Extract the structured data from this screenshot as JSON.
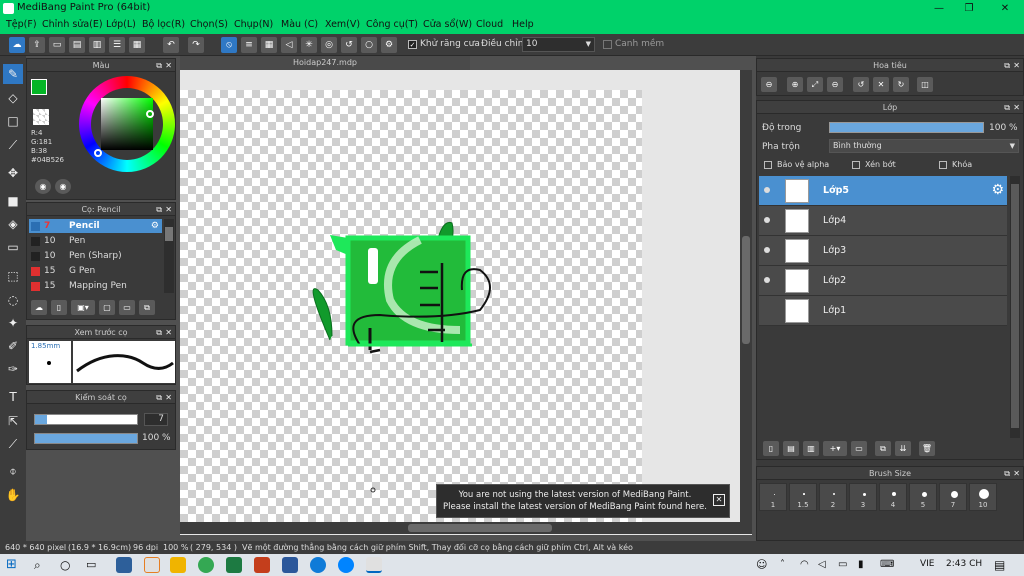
{
  "app": {
    "title": "MediBang Paint Pro (64bit)"
  },
  "menu": [
    "Tệp(F)",
    "Chỉnh sửa(E)",
    "Lớp(L)",
    "Bộ lọc(R)",
    "Chọn(S)",
    "Chụp(N)",
    "Màu (C)",
    "Xem(V)",
    "Công cụ(T)",
    "Cửa sổ(W)",
    "Cloud",
    "Help"
  ],
  "toolbar": {
    "antialias_label": "Khử răng cưa",
    "correction_label": "Điều chỉnh",
    "correction_value": "10",
    "edge_label": "Canh mềm"
  },
  "color_panel": {
    "title": "Màu",
    "r": "R:4",
    "g": "G:181",
    "b": "B:38",
    "hex": "#04B526",
    "primary": "#04B526",
    "secondary": "#ffffff"
  },
  "brush_panel": {
    "title": "Cọ: Pencil",
    "items": [
      {
        "size": "7",
        "name": "Pencil",
        "color": "#2b6fb3"
      },
      {
        "size": "10",
        "name": "Pen",
        "color": "#222222"
      },
      {
        "size": "10",
        "name": "Pen (Sharp)",
        "color": "#222222"
      },
      {
        "size": "15",
        "name": "G Pen",
        "color": "#e03030"
      },
      {
        "size": "15",
        "name": "Mapping Pen",
        "color": "#e03030"
      }
    ]
  },
  "preview_panel": {
    "title": "Xem trước cọ",
    "size": "1.85mm"
  },
  "brush_control": {
    "title": "Kiểm soát cọ",
    "size_value": "7",
    "opacity_value": "100 %"
  },
  "document": {
    "tab": "Hoidap247.mdp"
  },
  "navigator": {
    "title": "Hoa tiêu"
  },
  "layer_panel": {
    "title": "Lớp",
    "opacity_label": "Độ trong",
    "opacity_value": "100 %",
    "blend_label": "Pha trộn",
    "blend_value": "Bình thường",
    "protect_alpha": "Bảo vệ alpha",
    "clipping": "Xén bớt",
    "lock": "Khóa",
    "layers": [
      "Lớp5",
      "Lớp4",
      "Lớp3",
      "Lớp2",
      "Lớp1"
    ]
  },
  "brush_size_panel": {
    "title": "Brush Size",
    "sizes": [
      "1",
      "1.5",
      "2",
      "3",
      "4",
      "5",
      "7",
      "10"
    ]
  },
  "notification": {
    "line1": "You are not using the latest version of MediBang Paint.",
    "line2": "Please install the latest version of MediBang Paint found here."
  },
  "status": {
    "dims": "640 * 640 pixel",
    "cm": "(16.9 * 16.9cm)",
    "dpi": "96 dpi",
    "zoom": "100 %",
    "coords": "( 279, 534 )",
    "hint": "Vẽ một đường thẳng bằng cách giữ phím Shift, Thay đổi cỡ cọ bằng cách giữ phím Ctrl, Alt và kéo"
  },
  "taskbar": {
    "lang": "VIE",
    "time": "2:43 CH"
  }
}
